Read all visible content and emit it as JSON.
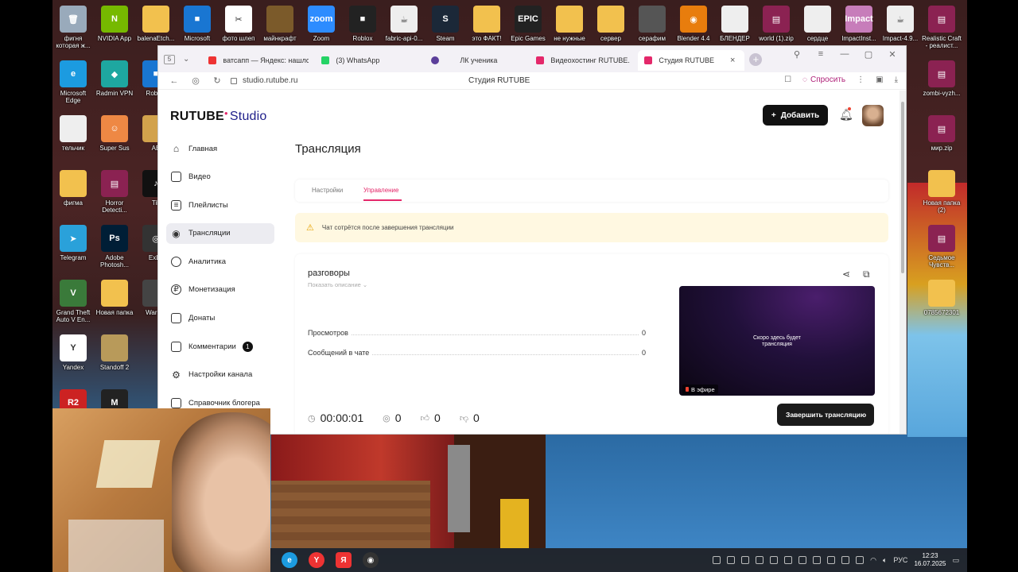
{
  "desktop": {
    "icons": [
      {
        "label": "фигня которая ж...",
        "color": "#9ab",
        "glyph": "🗑"
      },
      {
        "label": "NVIDIA App",
        "color": "#76b900",
        "glyph": "N"
      },
      {
        "label": "balenaEtch...",
        "color": "#f2c14e",
        "glyph": ""
      },
      {
        "label": "Microsoft",
        "color": "#1976d2",
        "glyph": "■"
      },
      {
        "label": "фото шлеп",
        "color": "#fff",
        "glyph": "✂"
      },
      {
        "label": "майнкрафт",
        "color": "#7b5a2a",
        "glyph": ""
      },
      {
        "label": "Zoom",
        "color": "#2d8cff",
        "glyph": "zoom"
      },
      {
        "label": "Roblox",
        "color": "#222",
        "glyph": "■"
      },
      {
        "label": "fabric-api-0...",
        "color": "#eee",
        "glyph": "☕"
      },
      {
        "label": "Steam",
        "color": "#1b2838",
        "glyph": "S"
      },
      {
        "label": "это ФАКТ!",
        "color": "#f2c14e",
        "glyph": ""
      },
      {
        "label": "Epic Games",
        "color": "#222",
        "glyph": "EPIC"
      },
      {
        "label": "не нужные",
        "color": "#f2c14e",
        "glyph": ""
      },
      {
        "label": "сервер",
        "color": "#f2c14e",
        "glyph": ""
      },
      {
        "label": "серафим",
        "color": "#555",
        "glyph": ""
      },
      {
        "label": "Blender 4.4",
        "color": "#e87d0d",
        "glyph": "◉"
      },
      {
        "label": "БЛЕНДЕР",
        "color": "#eee",
        "glyph": ""
      },
      {
        "label": "world (1).zip",
        "color": "#8b2252",
        "glyph": "▤"
      },
      {
        "label": "сердце",
        "color": "#eee",
        "glyph": ""
      },
      {
        "label": "ImpactInst...",
        "color": "#c77dba",
        "glyph": "Impact"
      },
      {
        "label": "Impact-4.9...",
        "color": "#eee",
        "glyph": "☕"
      },
      {
        "label": "Realistic Craft - реалист...",
        "color": "#8b2252",
        "glyph": "▤"
      },
      {
        "label": "Microsoft Edge",
        "color": "#1c9be0",
        "glyph": "e"
      },
      {
        "label": "Radmin VPN",
        "color": "#1ea7a0",
        "glyph": "◆"
      },
      {
        "label": "Roblox",
        "color": "#1976d2",
        "glyph": "■"
      },
      {
        "label": "тельчик",
        "color": "#eee",
        "glyph": ""
      },
      {
        "label": "Super Sus",
        "color": "#e84",
        "glyph": "☺"
      },
      {
        "label": "AB",
        "color": "#d2a24c",
        "glyph": ""
      },
      {
        "label": "фигма",
        "color": "#f2c14e",
        "glyph": ""
      },
      {
        "label": "Horror Detecti...",
        "color": "#8b2252",
        "glyph": "▤"
      },
      {
        "label": "Tik",
        "color": "#111",
        "glyph": "♪"
      },
      {
        "label": "Telegram",
        "color": "#2aa1da",
        "glyph": "➤"
      },
      {
        "label": "Adobe Photosh...",
        "color": "#001e36",
        "glyph": "Ps"
      },
      {
        "label": "ExLo",
        "color": "#333",
        "glyph": "◎"
      },
      {
        "label": "Grand Theft Auto V En...",
        "color": "#3a7a3a",
        "glyph": "V"
      },
      {
        "label": "Новая папка",
        "color": "#f2c14e",
        "glyph": ""
      },
      {
        "label": "War Th",
        "color": "#444",
        "glyph": ""
      },
      {
        "label": "Yandex",
        "color": "#fff",
        "glyph": "Y"
      },
      {
        "label": "Standoff 2",
        "color": "#b89a5a",
        "glyph": ""
      },
      {
        "label": "R2",
        "color": "#c22",
        "glyph": "R2"
      },
      {
        "label": "",
        "color": "#222",
        "glyph": "M"
      },
      {
        "label": "zombi-vyzh...",
        "color": "#8b2252",
        "glyph": "▤"
      },
      {
        "label": "мир.zip",
        "color": "#8b2252",
        "glyph": "▤"
      },
      {
        "label": "Новая папка (2)",
        "color": "#f2c14e",
        "glyph": ""
      },
      {
        "label": "Седьмое Чувств...",
        "color": "#8b2252",
        "glyph": "▤"
      },
      {
        "label": "0785672301",
        "color": "#f2c14e",
        "glyph": ""
      }
    ]
  },
  "browser": {
    "tab_count": "5",
    "tabs": [
      {
        "label": "ватсапп — Яндекс: нашлс",
        "color": "#e33"
      },
      {
        "label": "(3) WhatsApp",
        "color": "#25d366"
      },
      {
        "label": "ЛК ученика",
        "color": "#5b3e9a"
      },
      {
        "label": "Видеохостинг RUTUBE. С",
        "color": "#e4286a"
      },
      {
        "label": "Студия RUTUBE",
        "color": "#e4286a"
      }
    ],
    "url": "studio.rutube.ru",
    "page_title": "Студия RUTUBE",
    "ask_label": "Спросить"
  },
  "studio": {
    "logo_main": "RUTUBE",
    "logo_studio": "Studio",
    "add_button": "Добавить",
    "sidebar": [
      {
        "label": "Главная",
        "icon": "⌂"
      },
      {
        "label": "Видео",
        "icon": "▭"
      },
      {
        "label": "Плейлисты",
        "icon": "≡"
      },
      {
        "label": "Трансляции",
        "icon": "((•))"
      },
      {
        "label": "Аналитика",
        "icon": "◔"
      },
      {
        "label": "Монетизация",
        "icon": "₽"
      },
      {
        "label": "Донаты",
        "icon": "▢"
      },
      {
        "label": "Комментарии",
        "icon": "▭",
        "badge": "1"
      },
      {
        "label": "Настройки канала",
        "icon": "⚙"
      },
      {
        "label": "Справочник блогера",
        "icon": "▯"
      }
    ],
    "page_title": "Трансляция",
    "sub_tabs": [
      "Настройки",
      "Управление"
    ],
    "warning": "Чат сотрётся после завершения трансляции",
    "stream": {
      "name": "разговоры",
      "show_description": "Показать описание",
      "stats": [
        {
          "label": "Просмотров",
          "value": "0"
        },
        {
          "label": "Сообщений в чате",
          "value": "0"
        }
      ],
      "preview_text_1": "Скоро здесь будет",
      "preview_text_2": "трансляция",
      "live_label": "В эфире",
      "timer": "00:00:01",
      "viewers": "0",
      "likes": "0",
      "dislikes": "0",
      "end_button": "Завершить трансляцию"
    }
  },
  "taskbar": {
    "language": "РУС",
    "time": "12:23",
    "date": "16.07.2025"
  }
}
